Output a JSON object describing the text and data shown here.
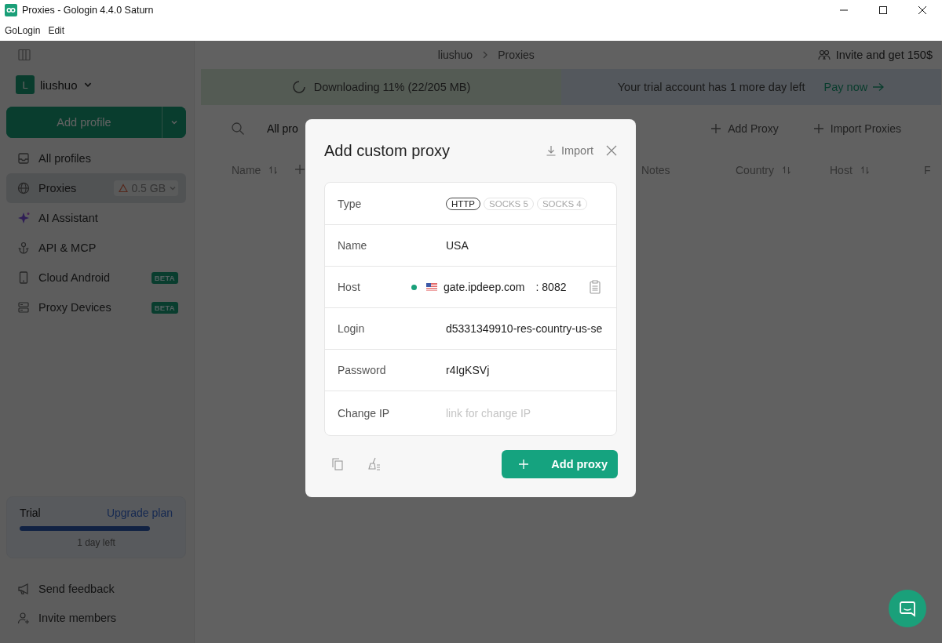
{
  "window": {
    "title": "Proxies - Gologin 4.4.0 Saturn",
    "menu": [
      "GoLogin",
      "Edit"
    ]
  },
  "sidebar": {
    "account": {
      "initial": "L",
      "name": "liushuo"
    },
    "add_profile": "Add profile",
    "items": [
      {
        "label": "All profiles",
        "selected": false
      },
      {
        "label": "Proxies",
        "selected": true,
        "usage": "0.5 GB"
      },
      {
        "label": "AI Assistant",
        "selected": false
      },
      {
        "label": "API & MCP",
        "selected": false
      },
      {
        "label": "Cloud Android",
        "selected": false,
        "badge": "BETA"
      },
      {
        "label": "Proxy Devices",
        "selected": false,
        "badge": "BETA"
      }
    ],
    "trial": {
      "label": "Trial",
      "link": "Upgrade plan",
      "level": 0.85,
      "remaining": "1 day left"
    },
    "footer_items": [
      {
        "label": "Send feedback"
      },
      {
        "label": "Invite members"
      }
    ]
  },
  "main": {
    "breadcrumb": [
      "liushuo",
      "Proxies"
    ],
    "invite": "Invite and get 150$",
    "download_banner": "Downloading 11% (22/205 MB)",
    "trial_banner": {
      "text": "Your trial account has 1 more day left",
      "link": "Pay now"
    },
    "toolbar": {
      "filter": "All pro",
      "add": "Add Proxy",
      "import": "Import Proxies"
    },
    "columns": [
      {
        "label": "Name",
        "sortable": true
      },
      {
        "label": "Notes",
        "sortable": false
      },
      {
        "label": "Country",
        "sortable": true
      },
      {
        "label": "Host",
        "sortable": true
      },
      {
        "label": "F",
        "sortable": false
      }
    ]
  },
  "dialog": {
    "title": "Add custom proxy",
    "import": "Import",
    "fields": [
      {
        "kind": "type",
        "label": "Type",
        "options": [
          {
            "label": "HTTP",
            "selected": true
          },
          {
            "label": "SOCKS 5",
            "selected": false
          },
          {
            "label": "SOCKS 4",
            "selected": false
          }
        ]
      },
      {
        "kind": "text",
        "label": "Name",
        "value": "USA"
      },
      {
        "kind": "host",
        "label": "Host",
        "value": "gate.ipdeep.com",
        "port": ": 8082"
      },
      {
        "kind": "text",
        "label": "Login",
        "value": "d5331349910-res-country-us-se"
      },
      {
        "kind": "text",
        "label": "Password",
        "value": "r4IgKSVj"
      },
      {
        "kind": "text",
        "label": "Change IP",
        "placeholder": "link for change IP"
      }
    ],
    "submit": "Add proxy"
  }
}
